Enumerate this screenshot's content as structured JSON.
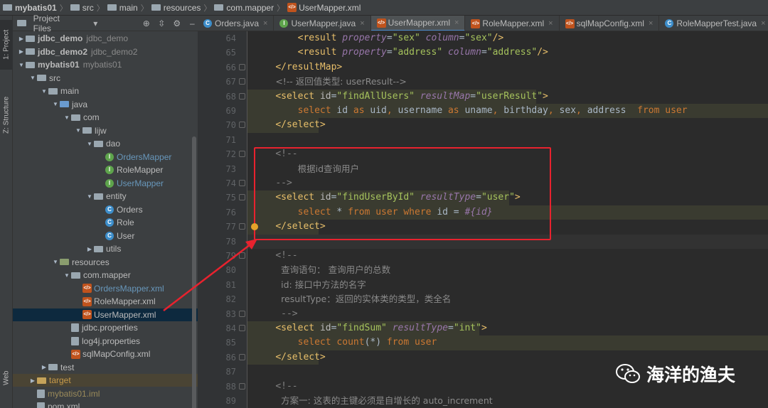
{
  "breadcrumb": [
    "mybatis01",
    "src",
    "main",
    "resources",
    "com.mapper",
    "UserMapper.xml"
  ],
  "sidebar": {
    "project_tab": "1: Project",
    "structure_tab": "Z: Structure",
    "web_tab": "Web"
  },
  "project": {
    "header": "Project Files",
    "tree": [
      {
        "label": "jdbc_demo",
        "dim": "jdbc_demo",
        "depth": 0,
        "arrow": "▶",
        "icon": "folder",
        "bold": true
      },
      {
        "label": "jdbc_demo2",
        "dim": "jdbc_demo2",
        "depth": 0,
        "arrow": "▶",
        "icon": "folder",
        "bold": true
      },
      {
        "label": "mybatis01",
        "dim": "mybatis01",
        "depth": 0,
        "arrow": "▼",
        "icon": "folder",
        "bold": true
      },
      {
        "label": "src",
        "depth": 1,
        "arrow": "▼",
        "icon": "folder"
      },
      {
        "label": "main",
        "depth": 2,
        "arrow": "▼",
        "icon": "folder"
      },
      {
        "label": "java",
        "depth": 3,
        "arrow": "▼",
        "icon": "folder-blue"
      },
      {
        "label": "com",
        "depth": 4,
        "arrow": "▼",
        "icon": "folder"
      },
      {
        "label": "lijw",
        "depth": 5,
        "arrow": "▼",
        "icon": "folder"
      },
      {
        "label": "dao",
        "depth": 6,
        "arrow": "▼",
        "icon": "folder"
      },
      {
        "label": "OrdersMapper",
        "depth": 7,
        "icon": "interface",
        "color": "#6897bb"
      },
      {
        "label": "RoleMapper",
        "depth": 7,
        "icon": "interface"
      },
      {
        "label": "UserMapper",
        "depth": 7,
        "icon": "interface",
        "color": "#6897bb"
      },
      {
        "label": "entity",
        "depth": 6,
        "arrow": "▼",
        "icon": "folder"
      },
      {
        "label": "Orders",
        "depth": 7,
        "icon": "class"
      },
      {
        "label": "Role",
        "depth": 7,
        "icon": "class"
      },
      {
        "label": "User",
        "depth": 7,
        "icon": "class"
      },
      {
        "label": "utils",
        "depth": 6,
        "arrow": "▶",
        "icon": "folder"
      },
      {
        "label": "resources",
        "depth": 3,
        "arrow": "▼",
        "icon": "folder-res"
      },
      {
        "label": "com.mapper",
        "depth": 4,
        "arrow": "▼",
        "icon": "folder"
      },
      {
        "label": "OrdersMapper.xml",
        "depth": 5,
        "icon": "xml",
        "color": "#6897bb"
      },
      {
        "label": "RoleMapper.xml",
        "depth": 5,
        "icon": "xml"
      },
      {
        "label": "UserMapper.xml",
        "depth": 5,
        "icon": "xml",
        "selected": true
      },
      {
        "label": "jdbc.properties",
        "depth": 4,
        "icon": "file"
      },
      {
        "label": "log4j.properties",
        "depth": 4,
        "icon": "file"
      },
      {
        "label": "sqlMapConfig.xml",
        "depth": 4,
        "icon": "xml"
      },
      {
        "label": "test",
        "depth": 2,
        "arrow": "▶",
        "icon": "folder"
      },
      {
        "label": "target",
        "depth": 1,
        "arrow": "▶",
        "icon": "folder-orange",
        "color": "#c79a4a",
        "target": true
      },
      {
        "label": "mybatis01.iml",
        "depth": 1,
        "icon": "file",
        "color": "#9a8a5a"
      },
      {
        "label": "pom.xml",
        "depth": 1,
        "icon": "file"
      }
    ]
  },
  "tabs": [
    {
      "label": "Orders.java",
      "icon": "class"
    },
    {
      "label": "UserMapper.java",
      "icon": "interface"
    },
    {
      "label": "UserMapper.xml",
      "icon": "xml",
      "active": true
    },
    {
      "label": "RoleMapper.xml",
      "icon": "xml"
    },
    {
      "label": "sqlMapConfig.xml",
      "icon": "xml"
    },
    {
      "label": "RoleMapperTest.java",
      "icon": "class"
    },
    {
      "label": "Or",
      "icon": "class"
    }
  ],
  "editor": {
    "line_numbers": [
      "64",
      "65",
      "66",
      "67",
      "68",
      "69",
      "70",
      "71",
      "72",
      "73",
      "74",
      "75",
      "76",
      "77",
      "78",
      "79",
      "80",
      "81",
      "82",
      "83",
      "84",
      "85",
      "86",
      "87",
      "88",
      "89"
    ],
    "lines": [
      [
        {
          "c": "tx",
          "t": "        "
        },
        {
          "c": "t",
          "t": "<result "
        },
        {
          "c": "ai",
          "t": "property"
        },
        {
          "c": "tx",
          "t": "="
        },
        {
          "c": "v",
          "t": "\"sex\" "
        },
        {
          "c": "ai",
          "t": "column"
        },
        {
          "c": "tx",
          "t": "="
        },
        {
          "c": "v",
          "t": "\"sex\""
        },
        {
          "c": "t",
          "t": "/>"
        }
      ],
      [
        {
          "c": "tx",
          "t": "        "
        },
        {
          "c": "t",
          "t": "<result "
        },
        {
          "c": "ai",
          "t": "property"
        },
        {
          "c": "tx",
          "t": "="
        },
        {
          "c": "v",
          "t": "\"address\" "
        },
        {
          "c": "ai",
          "t": "column"
        },
        {
          "c": "tx",
          "t": "="
        },
        {
          "c": "v",
          "t": "\"address\""
        },
        {
          "c": "t",
          "t": "/>"
        }
      ],
      [
        {
          "c": "tx",
          "t": "    "
        },
        {
          "c": "t",
          "t": "</resultMap>"
        }
      ],
      [
        {
          "c": "tx",
          "t": "    "
        },
        {
          "c": "cm",
          "t": "<!-- 返回值类型: userResult-->"
        }
      ],
      [
        {
          "c": "tx",
          "t": "    "
        },
        {
          "c": "t",
          "t": "<select "
        },
        {
          "c": "a",
          "t": "id"
        },
        {
          "c": "tx",
          "t": "="
        },
        {
          "c": "v",
          "t": "\"findAllUsers\" "
        },
        {
          "c": "ai",
          "t": "resultMap"
        },
        {
          "c": "tx",
          "t": "="
        },
        {
          "c": "v",
          "t": "\"userResult\""
        },
        {
          "c": "t",
          "t": ">"
        }
      ],
      [
        {
          "c": "tx",
          "t": "        "
        },
        {
          "c": "k",
          "t": "select "
        },
        {
          "c": "tx",
          "t": "id "
        },
        {
          "c": "k",
          "t": "as "
        },
        {
          "c": "tx",
          "t": "uid"
        },
        {
          "c": "k",
          "t": ", "
        },
        {
          "c": "tx",
          "t": "username "
        },
        {
          "c": "k",
          "t": "as "
        },
        {
          "c": "tx",
          "t": "uname"
        },
        {
          "c": "k",
          "t": ", "
        },
        {
          "c": "tx",
          "t": "birthday"
        },
        {
          "c": "k",
          "t": ", "
        },
        {
          "c": "tx",
          "t": "sex"
        },
        {
          "c": "k",
          "t": ", "
        },
        {
          "c": "tx",
          "t": "address  "
        },
        {
          "c": "k",
          "t": "from user"
        }
      ],
      [
        {
          "c": "tx",
          "t": "    "
        },
        {
          "c": "t",
          "t": "</select>"
        }
      ],
      [],
      [
        {
          "c": "tx",
          "t": "    "
        },
        {
          "c": "cm",
          "t": "<!--"
        }
      ],
      [
        {
          "c": "tx",
          "t": "        "
        },
        {
          "c": "cm",
          "t": "根据id查询用户"
        }
      ],
      [
        {
          "c": "tx",
          "t": "    "
        },
        {
          "c": "cm",
          "t": "-->"
        }
      ],
      [
        {
          "c": "tx",
          "t": "    "
        },
        {
          "c": "t",
          "t": "<select "
        },
        {
          "c": "a",
          "t": "id"
        },
        {
          "c": "tx",
          "t": "="
        },
        {
          "c": "v",
          "t": "\"findUserById\" "
        },
        {
          "c": "ai",
          "t": "resultType"
        },
        {
          "c": "tx",
          "t": "="
        },
        {
          "c": "v",
          "t": "\"user\""
        },
        {
          "c": "t",
          "t": ">"
        }
      ],
      [
        {
          "c": "tx",
          "t": "        "
        },
        {
          "c": "k",
          "t": "select "
        },
        {
          "c": "tx",
          "t": "* "
        },
        {
          "c": "k",
          "t": "from user where "
        },
        {
          "c": "tx",
          "t": "id = "
        },
        {
          "c": "pm",
          "t": "#{id}"
        }
      ],
      [
        {
          "c": "tx",
          "t": "    "
        },
        {
          "c": "t",
          "t": "</select>"
        }
      ],
      [],
      [
        {
          "c": "tx",
          "t": "    "
        },
        {
          "c": "cm",
          "t": "<!--"
        }
      ],
      [
        {
          "c": "tx",
          "t": "     "
        },
        {
          "c": "cm",
          "t": "查询语句： 查询用户的总数"
        }
      ],
      [
        {
          "c": "tx",
          "t": "     "
        },
        {
          "c": "cm",
          "t": "id: 接口中方法的名字"
        }
      ],
      [
        {
          "c": "tx",
          "t": "     "
        },
        {
          "c": "cm",
          "t": "resultType：返回的实体类的类型，类全名"
        }
      ],
      [
        {
          "c": "tx",
          "t": "     "
        },
        {
          "c": "cm",
          "t": "-->"
        }
      ],
      [
        {
          "c": "tx",
          "t": "    "
        },
        {
          "c": "t",
          "t": "<select "
        },
        {
          "c": "a",
          "t": "id"
        },
        {
          "c": "tx",
          "t": "="
        },
        {
          "c": "v",
          "t": "\"findSum\" "
        },
        {
          "c": "ai",
          "t": "resultType"
        },
        {
          "c": "tx",
          "t": "="
        },
        {
          "c": "v",
          "t": "\"int\""
        },
        {
          "c": "t",
          "t": ">"
        }
      ],
      [
        {
          "c": "tx",
          "t": "        "
        },
        {
          "c": "k",
          "t": "select "
        },
        {
          "c": "k",
          "t": "count"
        },
        {
          "c": "tx",
          "t": "(*) "
        },
        {
          "c": "k",
          "t": "from user"
        }
      ],
      [
        {
          "c": "tx",
          "t": "    "
        },
        {
          "c": "t",
          "t": "</select>"
        }
      ],
      [],
      [
        {
          "c": "tx",
          "t": "    "
        },
        {
          "c": "cm",
          "t": "<!--"
        }
      ],
      [
        {
          "c": "tx",
          "t": "     "
        },
        {
          "c": "cm",
          "t": "方案一: 这表的主键必须是自增长的 auto_increment"
        }
      ]
    ],
    "current_line": "78"
  },
  "watermark": "海洋的渔夫"
}
